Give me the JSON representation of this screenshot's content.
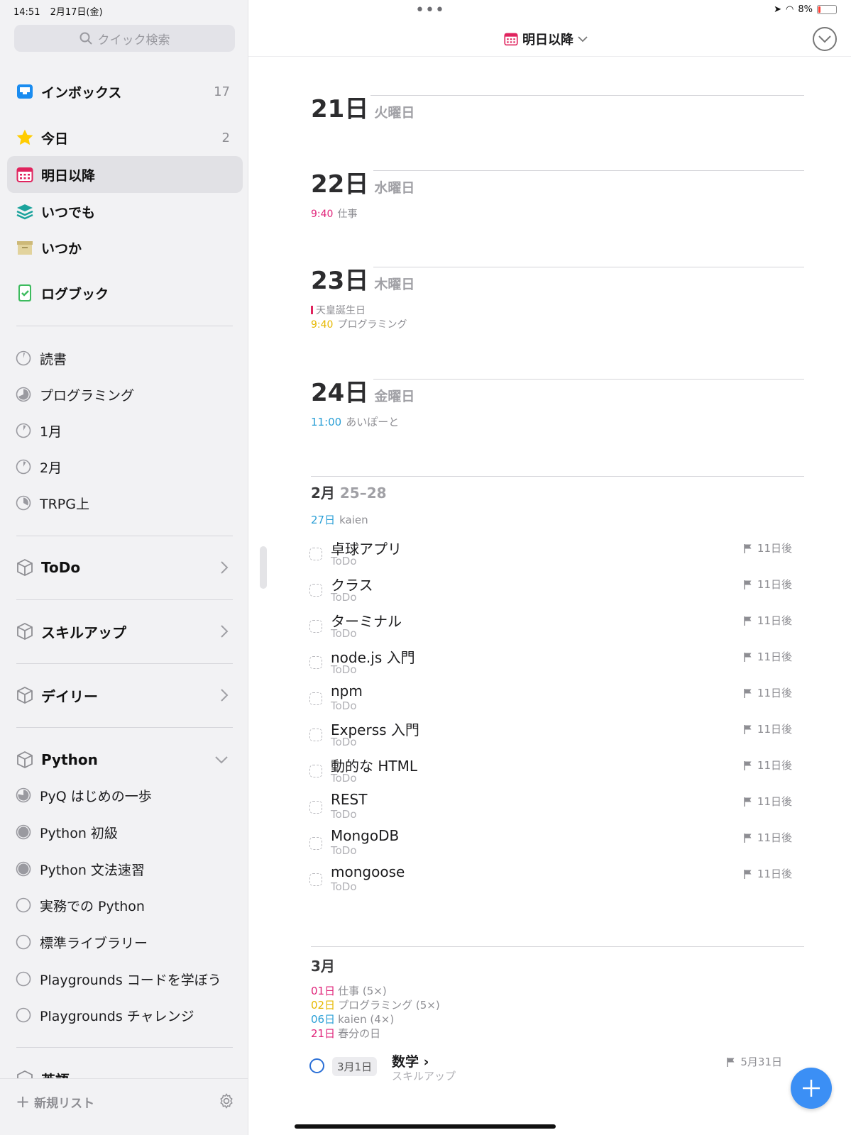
{
  "status": {
    "time": "14:51",
    "date": "2月17日(金)",
    "battery": "8%"
  },
  "sidebar": {
    "search_placeholder": "クイック検索",
    "nav": [
      {
        "label": "インボックス",
        "count": "17",
        "icon": "inbox-icon"
      },
      {
        "label": "今日",
        "count": "2",
        "icon": "star-icon"
      },
      {
        "label": "明日以降",
        "count": "",
        "icon": "calendar-icon"
      },
      {
        "label": "いつでも",
        "count": "",
        "icon": "layers-icon"
      },
      {
        "label": "いつか",
        "count": "",
        "icon": "archive-box-icon"
      },
      {
        "label": "ログブック",
        "count": "",
        "icon": "logbook-icon"
      }
    ],
    "projects_top": [
      "読書",
      "プログラミング",
      "1月",
      "2月",
      "TRPG上"
    ],
    "areas": [
      "ToDo",
      "スキルアップ",
      "デイリー"
    ],
    "python_area": "Python",
    "python_projects": [
      "PyQ はじめの一歩",
      "Python 初級",
      "Python 文法速習",
      "実務での Python",
      "標準ライブラリー",
      "Playgrounds コードを学ぼう",
      "Playgrounds チャレンジ"
    ],
    "cut_area": "英語",
    "new_list": "新規リスト"
  },
  "main": {
    "title": "明日以降",
    "days": [
      {
        "num": "21日",
        "weekday": "火曜日"
      },
      {
        "num": "22日",
        "weekday": "水曜日"
      },
      {
        "num": "23日",
        "weekday": "木曜日"
      },
      {
        "num": "24日",
        "weekday": "金曜日"
      }
    ],
    "events": {
      "d22": {
        "time": "9:40",
        "label": "仕事",
        "color": "#e0247a"
      },
      "d23_holiday": "天皇誕生日",
      "d23": {
        "time": "9:40",
        "label": "プログラミング",
        "color": "#e6b800"
      },
      "d24": {
        "time": "11:00",
        "label": "あいぽーと",
        "color": "#2a9fd6"
      }
    },
    "range": {
      "month": "2月",
      "days": "25–28"
    },
    "range_event": {
      "day": "27日",
      "label": "kaien",
      "color": "#2a9fd6"
    },
    "todos": [
      {
        "title": "卓球アプリ",
        "area": "ToDo",
        "due": "11日後"
      },
      {
        "title": "クラス",
        "area": "ToDo",
        "due": "11日後"
      },
      {
        "title": "ターミナル",
        "area": "ToDo",
        "due": "11日後"
      },
      {
        "title": "node.js 入門",
        "area": "ToDo",
        "due": "11日後"
      },
      {
        "title": "npm",
        "area": "ToDo",
        "due": "11日後"
      },
      {
        "title": "Experss 入門",
        "area": "ToDo",
        "due": "11日後"
      },
      {
        "title": "動的な HTML",
        "area": "ToDo",
        "due": "11日後"
      },
      {
        "title": "REST",
        "area": "ToDo",
        "due": "11日後"
      },
      {
        "title": "MongoDB",
        "area": "ToDo",
        "due": "11日後"
      },
      {
        "title": "mongoose",
        "area": "ToDo",
        "due": "11日後"
      }
    ],
    "month": "3月",
    "month_events": [
      {
        "day": "01日",
        "label": "仕事 (5×)",
        "color": "#e0247a"
      },
      {
        "day": "02日",
        "label": "プログラミング (5×)",
        "color": "#e6b800"
      },
      {
        "day": "06日",
        "label": "kaien  (4×)",
        "color": "#2a9fd6"
      },
      {
        "day": "21日",
        "label": "春分の日",
        "color": "#e0247a"
      }
    ],
    "scheduled": {
      "date": "3月1日",
      "title": "数学",
      "area": "スキルアップ",
      "due": "5月31日"
    }
  }
}
